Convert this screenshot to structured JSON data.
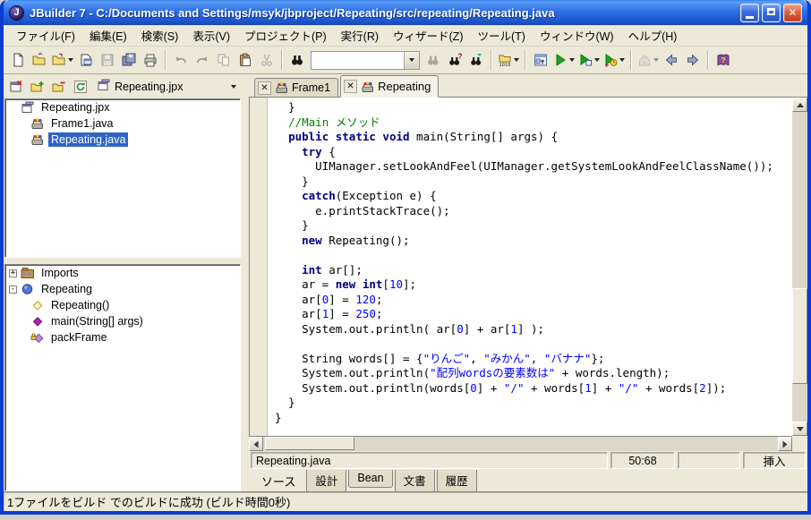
{
  "window": {
    "title": "JBuilder 7 - C:/Documents and Settings/msyk/jbproject/Repeating/src/repeating/Repeating.java",
    "app_icon_letter": "J",
    "controls": {
      "minimize": "minimize",
      "maximize": "maximize",
      "close": "close"
    }
  },
  "colors": {
    "titlebar_blue": "#2e6fe6",
    "chrome_beige": "#ece9d8",
    "selection_blue": "#2f64c8",
    "keyword": "#000080",
    "comment": "#008000",
    "string_number": "#0000ff",
    "run_green": "#1ca51c"
  },
  "menu": {
    "items": [
      "ファイル(F)",
      "編集(E)",
      "検索(S)",
      "表示(V)",
      "プロジェクト(P)",
      "実行(R)",
      "ウィザード(Z)",
      "ツール(T)",
      "ウィンドウ(W)",
      "ヘルプ(H)"
    ]
  },
  "toolbar": {
    "search_value": "",
    "items": [
      {
        "name": "new-file"
      },
      {
        "name": "open-file"
      },
      {
        "name": "reopen",
        "caret": true
      },
      {
        "name": "close-file"
      },
      {
        "name": "save",
        "disabled": true
      },
      {
        "name": "save-all"
      },
      {
        "name": "print"
      },
      {
        "sep": true
      },
      {
        "name": "undo",
        "disabled": true
      },
      {
        "name": "redo",
        "disabled": true
      },
      {
        "name": "copy",
        "disabled": true
      },
      {
        "name": "paste"
      },
      {
        "name": "cut",
        "disabled": true
      },
      {
        "sep": true
      },
      {
        "name": "find"
      },
      {
        "combo": true
      },
      {
        "name": "find-next",
        "disabled": true
      },
      {
        "name": "find-incremental"
      },
      {
        "name": "find-in-path"
      },
      {
        "sep": true
      },
      {
        "name": "make-project",
        "caret": true
      },
      {
        "sep": true
      },
      {
        "name": "ui-designer"
      },
      {
        "name": "run",
        "caret": true
      },
      {
        "name": "debug",
        "caret": true
      },
      {
        "name": "profile",
        "caret": true
      },
      {
        "sep": true
      },
      {
        "name": "home",
        "disabled": true,
        "caret": true
      },
      {
        "name": "back"
      },
      {
        "name": "forward"
      },
      {
        "sep": true
      },
      {
        "name": "help"
      }
    ]
  },
  "project_pane": {
    "toolbar": [
      {
        "name": "close-project"
      },
      {
        "name": "add-file"
      },
      {
        "name": "remove-file"
      },
      {
        "name": "refresh-project"
      }
    ],
    "combo_value": "Repeating.jpx",
    "tree": [
      {
        "label": "Repeating.jpx",
        "icon": "project",
        "level": 0,
        "selected": false
      },
      {
        "label": "Frame1.java",
        "icon": "class-file",
        "level": 1,
        "selected": false
      },
      {
        "label": "Repeating.java",
        "icon": "class-file",
        "level": 1,
        "selected": true
      }
    ]
  },
  "structure_pane": {
    "tree": [
      {
        "label": "Imports",
        "icon": "imports",
        "level": 0,
        "expander": "+"
      },
      {
        "label": "Repeating",
        "icon": "class",
        "level": 0,
        "expander": "-"
      },
      {
        "label": "Repeating()",
        "icon": "constructor",
        "level": 1
      },
      {
        "label": "main(String[] args)",
        "icon": "method",
        "level": 1
      },
      {
        "label": "packFrame",
        "icon": "method-private",
        "level": 1
      }
    ]
  },
  "editor": {
    "tabs": [
      {
        "label": "Frame1",
        "active": false
      },
      {
        "label": "Repeating",
        "active": true
      }
    ],
    "lines": [
      [
        {
          "c": "p",
          "t": "  }"
        }
      ],
      [
        {
          "c": "p",
          "t": "  "
        },
        {
          "c": "c",
          "t": "//Main メソッド"
        }
      ],
      [
        {
          "c": "p",
          "t": "  "
        },
        {
          "c": "k",
          "t": "public static void"
        },
        {
          "c": "p",
          "t": " main(String[] args) {"
        }
      ],
      [
        {
          "c": "p",
          "t": "    "
        },
        {
          "c": "k",
          "t": "try"
        },
        {
          "c": "p",
          "t": " {"
        }
      ],
      [
        {
          "c": "p",
          "t": "      UIManager.setLookAndFeel(UIManager.getSystemLookAndFeelClassName());"
        }
      ],
      [
        {
          "c": "p",
          "t": "    }"
        }
      ],
      [
        {
          "c": "p",
          "t": "    "
        },
        {
          "c": "k",
          "t": "catch"
        },
        {
          "c": "p",
          "t": "(Exception e) {"
        }
      ],
      [
        {
          "c": "p",
          "t": "      e.printStackTrace();"
        }
      ],
      [
        {
          "c": "p",
          "t": "    }"
        }
      ],
      [
        {
          "c": "p",
          "t": "    "
        },
        {
          "c": "k",
          "t": "new"
        },
        {
          "c": "p",
          "t": " Repeating();"
        }
      ],
      [],
      [
        {
          "c": "p",
          "t": "    "
        },
        {
          "c": "k",
          "t": "int"
        },
        {
          "c": "p",
          "t": " ar[];"
        }
      ],
      [
        {
          "c": "p",
          "t": "    ar = "
        },
        {
          "c": "k",
          "t": "new int"
        },
        {
          "c": "p",
          "t": "["
        },
        {
          "c": "n",
          "t": "10"
        },
        {
          "c": "p",
          "t": "];"
        }
      ],
      [
        {
          "c": "p",
          "t": "    ar["
        },
        {
          "c": "n",
          "t": "0"
        },
        {
          "c": "p",
          "t": "] = "
        },
        {
          "c": "n",
          "t": "120"
        },
        {
          "c": "p",
          "t": ";"
        }
      ],
      [
        {
          "c": "p",
          "t": "    ar["
        },
        {
          "c": "n",
          "t": "1"
        },
        {
          "c": "p",
          "t": "] = "
        },
        {
          "c": "n",
          "t": "250"
        },
        {
          "c": "p",
          "t": ";"
        }
      ],
      [
        {
          "c": "p",
          "t": "    System.out.println( ar["
        },
        {
          "c": "n",
          "t": "0"
        },
        {
          "c": "p",
          "t": "] + ar["
        },
        {
          "c": "n",
          "t": "1"
        },
        {
          "c": "p",
          "t": "] );"
        }
      ],
      [],
      [
        {
          "c": "p",
          "t": "    String words[] = {"
        },
        {
          "c": "s",
          "t": "\"りんご\""
        },
        {
          "c": "p",
          "t": ", "
        },
        {
          "c": "s",
          "t": "\"みかん\""
        },
        {
          "c": "p",
          "t": ", "
        },
        {
          "c": "s",
          "t": "\"バナナ\""
        },
        {
          "c": "p",
          "t": "};"
        }
      ],
      [
        {
          "c": "p",
          "t": "    System.out.println("
        },
        {
          "c": "s",
          "t": "\"配列wordsの要素数は\""
        },
        {
          "c": "p",
          "t": " + words.length);"
        }
      ],
      [
        {
          "c": "p",
          "t": "    System.out.println(words["
        },
        {
          "c": "n",
          "t": "0"
        },
        {
          "c": "p",
          "t": "] + "
        },
        {
          "c": "s",
          "t": "\"/\""
        },
        {
          "c": "p",
          "t": " + words["
        },
        {
          "c": "n",
          "t": "1"
        },
        {
          "c": "p",
          "t": "] + "
        },
        {
          "c": "s",
          "t": "\"/\""
        },
        {
          "c": "p",
          "t": " + words["
        },
        {
          "c": "n",
          "t": "2"
        },
        {
          "c": "p",
          "t": "]);"
        }
      ],
      [
        {
          "c": "p",
          "t": "  }"
        }
      ],
      [
        {
          "c": "p",
          "t": "}"
        }
      ]
    ]
  },
  "status_bar": {
    "file": "Repeating.java",
    "position": "50:68",
    "mode": "",
    "insert_mode": "挿入"
  },
  "view_tabs": {
    "items": [
      {
        "label": "ソース",
        "active": true
      },
      {
        "label": "設計",
        "active": false
      },
      {
        "label": "Bean",
        "active": false
      },
      {
        "label": "文書",
        "active": false
      },
      {
        "label": "履歴",
        "active": false
      }
    ]
  },
  "message_bar": {
    "text": "1ファイルをビルド でのビルドに成功 (ビルド時間0秒)"
  }
}
